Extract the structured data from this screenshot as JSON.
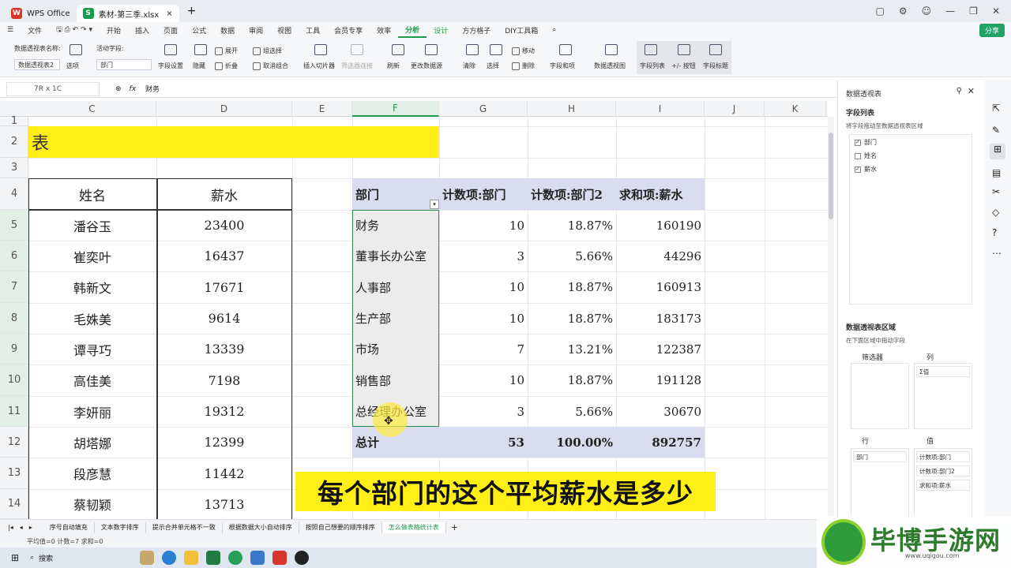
{
  "titlebar": {
    "tabs": [
      {
        "label": "WPS Office"
      },
      {
        "label": "素材-第三季.xlsx"
      }
    ],
    "new_tab": "+"
  },
  "menubar": {
    "file": "文件",
    "items": [
      "开始",
      "插入",
      "页面",
      "公式",
      "数据",
      "审阅",
      "视图",
      "工具",
      "会员专享",
      "效率",
      "分析",
      "设计",
      "方方格子",
      "DIY工具箱"
    ],
    "active": "分析",
    "share": "分享"
  },
  "ribbon": {
    "pivot_name_label": "数据透视表名称:",
    "pivot_name": "数据透视表2",
    "options": "选项",
    "active_field_label": "活动字段:",
    "active_field": "部门",
    "field_settings": "字段设置",
    "hide": "隐藏",
    "expand": "展开",
    "collapse": "折叠",
    "group_select": "组选择",
    "ungroup": "取消组合",
    "insert_slicer": "插入切片器",
    "filter_conn": "筛选器连接",
    "refresh": "刷新",
    "change_source": "更改数据源",
    "clear": "清除",
    "select": "选择",
    "move": "移动",
    "delete": "删除",
    "fields_items": "字段和项",
    "pivot_chart": "数据透视图",
    "field_list": "字段列表",
    "plus_minus": "+/- 按钮",
    "field_headers": "字段标题"
  },
  "formula_bar": {
    "name_box": "7R x 1C",
    "fx": "fx",
    "value": "财务"
  },
  "columns": [
    "C",
    "D",
    "E",
    "F",
    "G",
    "H",
    "I",
    "J",
    "K"
  ],
  "rows": [
    "1",
    "2",
    "3",
    "4",
    "5",
    "6",
    "7",
    "8",
    "9",
    "10",
    "11",
    "12",
    "13",
    "14"
  ],
  "sheet": {
    "title_cell": "表",
    "table_headers": [
      "姓名",
      "薪水"
    ],
    "table_rows": [
      [
        "潘谷玉",
        "23400"
      ],
      [
        "崔奕叶",
        "16437"
      ],
      [
        "韩新文",
        "17671"
      ],
      [
        "毛姝美",
        "9614"
      ],
      [
        "谭寻巧",
        "13339"
      ],
      [
        "高佳美",
        "7198"
      ],
      [
        "李妍丽",
        "19312"
      ],
      [
        "胡塔娜",
        "12399"
      ],
      [
        "段彦慧",
        "11442"
      ],
      [
        "蔡韧颖",
        "13713"
      ]
    ],
    "pivot_headers": [
      "部门",
      "计数项:部门",
      "计数项:部门2",
      "求和项:薪水"
    ],
    "pivot_rows": [
      [
        "财务",
        "10",
        "18.87%",
        "160190"
      ],
      [
        "董事长办公室",
        "3",
        "5.66%",
        "44296"
      ],
      [
        "人事部",
        "10",
        "18.87%",
        "160913"
      ],
      [
        "生产部",
        "10",
        "18.87%",
        "183173"
      ],
      [
        "市场",
        "7",
        "13.21%",
        "122387"
      ],
      [
        "销售部",
        "10",
        "18.87%",
        "191128"
      ],
      [
        "总经理办公室",
        "3",
        "5.66%",
        "30670"
      ]
    ],
    "pivot_total": [
      "总计",
      "53",
      "100.00%",
      "892757"
    ]
  },
  "panel": {
    "title": "数据透视表",
    "field_list_label": "字段列表",
    "drag_hint": "将字段拖动至数据透视表区域",
    "fields": [
      {
        "label": "部门",
        "checked": true
      },
      {
        "label": "姓名",
        "checked": false
      },
      {
        "label": "薪水",
        "checked": true
      }
    ],
    "areas_label": "数据透视表区域",
    "areas_hint": "在下面区域中拖动字段",
    "filter_label": "筛选器",
    "col_label": "列",
    "row_label": "行",
    "value_label": "值",
    "col_items": [
      "Σ值"
    ],
    "row_items": [
      "部门"
    ],
    "value_items": [
      "计数项:部门",
      "计数项:部门2",
      "求和项:薪水"
    ]
  },
  "sheet_tabs": [
    "序号自动填充",
    "文本数字排序",
    "提示合并单元格不一致",
    "根据数据大小自动排序",
    "按照自己想要的顺序排序",
    "怎么做表格统计表"
  ],
  "active_sheet": "怎么做表格统计表",
  "statusbar": "平均值=0  计数=7  求和=0",
  "taskbar": {
    "search": "搜索"
  },
  "caption": "每个部门的这个平均薪水是多少",
  "watermark": {
    "text": "毕博手游网",
    "url": "www.uqigou.com"
  },
  "colors": {
    "accent": "#1f9a4c",
    "yellow": "#ffef17",
    "pivot_header": "#d9dcef"
  }
}
